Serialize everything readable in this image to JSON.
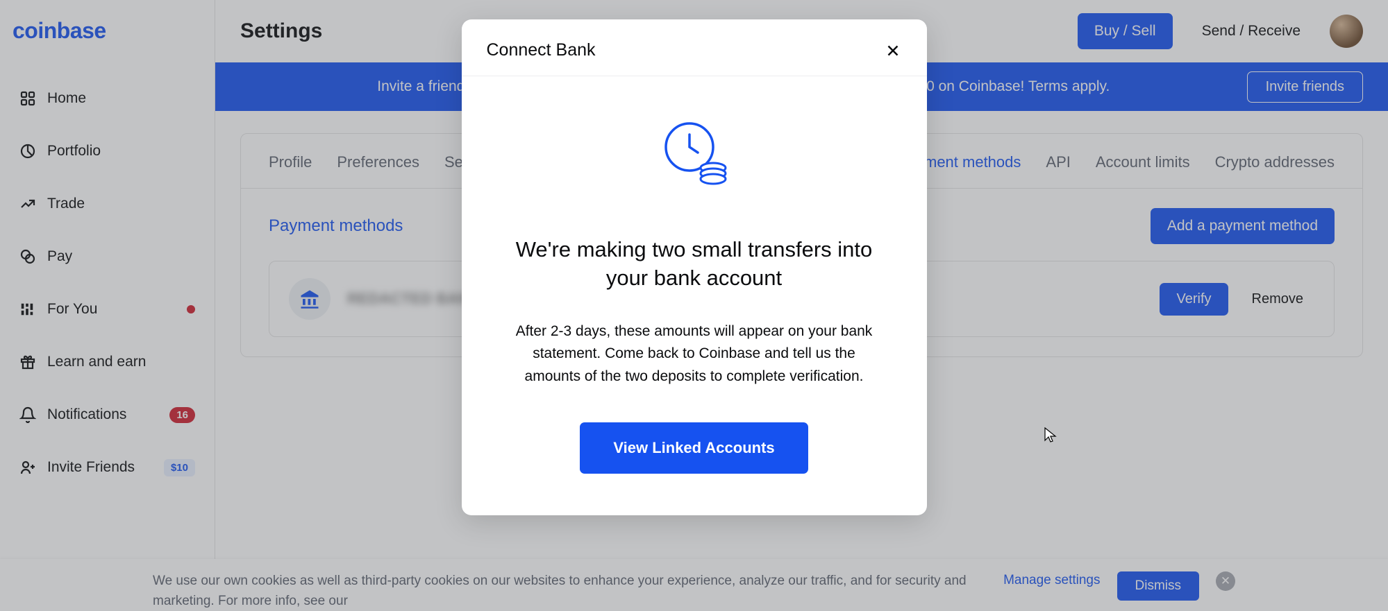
{
  "brand": "coinbase",
  "header": {
    "page_title": "Settings",
    "buy_sell_label": "Buy / Sell",
    "send_receive_label": "Send / Receive"
  },
  "sidebar": {
    "items": [
      {
        "label": "Home"
      },
      {
        "label": "Portfolio"
      },
      {
        "label": "Trade"
      },
      {
        "label": "Pay"
      },
      {
        "label": "For You",
        "dot": true
      },
      {
        "label": "Learn and earn"
      },
      {
        "label": "Notifications",
        "badge": "16"
      },
      {
        "label": "Invite Friends",
        "price": "$10"
      }
    ]
  },
  "banner": {
    "text": "Invite a friend to Coinbase and you'll both get $10 when they buy or sell their first $100 on Coinbase! Terms apply.",
    "cta": "Invite friends"
  },
  "tabs": {
    "items": [
      {
        "label": "Profile"
      },
      {
        "label": "Preferences"
      },
      {
        "label": "Security"
      },
      {
        "label": "Payment methods",
        "active": true
      },
      {
        "label": "API"
      },
      {
        "label": "Account limits"
      },
      {
        "label": "Crypto addresses"
      }
    ]
  },
  "payment_methods": {
    "title": "Payment methods",
    "add_button": "Add a payment method",
    "row": {
      "masked_name": "REDACTED BANK",
      "verify_label": "Verify",
      "remove_label": "Remove"
    }
  },
  "modal": {
    "title": "Connect Bank",
    "heading": "We're making two small transfers into your bank account",
    "description": "After 2-3 days, these amounts will appear on your bank statement. Come back to Coinbase and tell us the amounts of the two deposits to complete verification.",
    "cta": "View Linked Accounts"
  },
  "cookie": {
    "text": "We use our own cookies as well as third-party cookies on our websites to enhance your experience, analyze our traffic, and for security and marketing. For more info, see our",
    "manage": "Manage settings",
    "dismiss": "Dismiss"
  }
}
